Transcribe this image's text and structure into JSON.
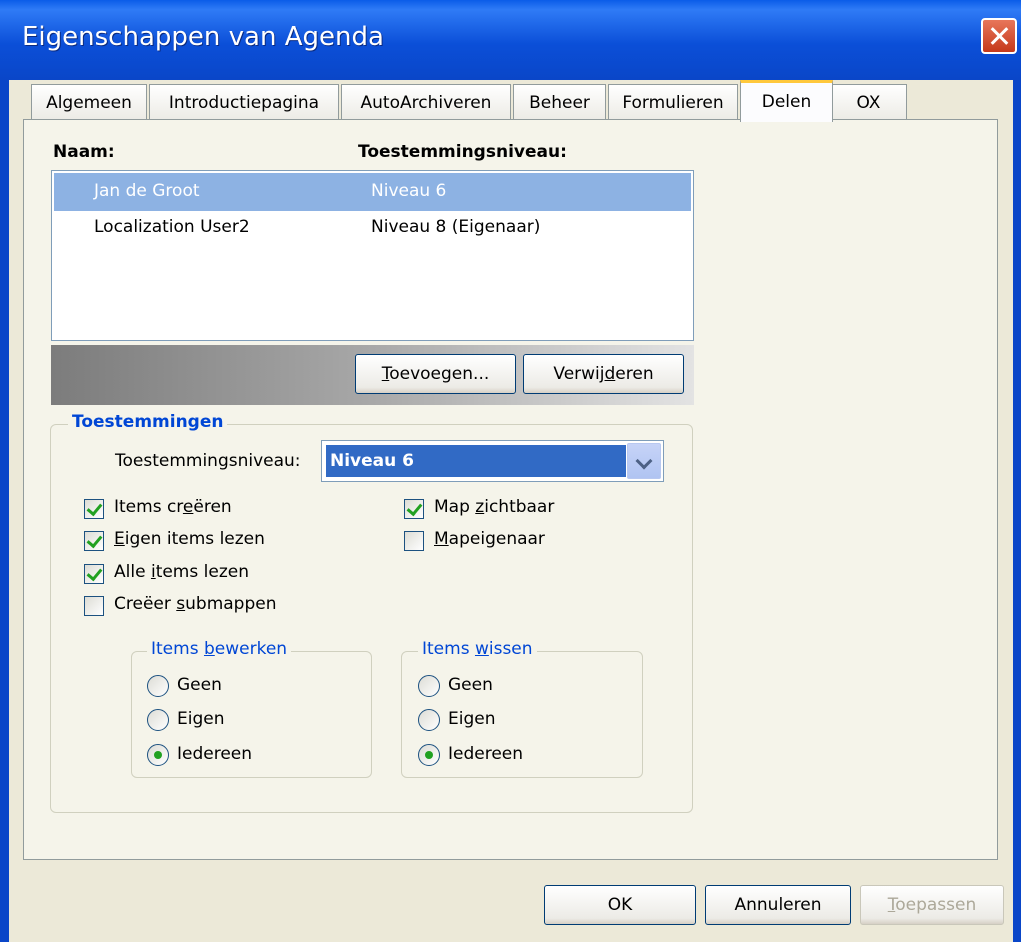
{
  "window": {
    "title": "Eigenschappen van Agenda"
  },
  "tabs": [
    "Algemeen",
    "Introductiepagina",
    "AutoArchiveren",
    "Beheer",
    "Formulieren",
    "Delen",
    "OX"
  ],
  "active_tab": "Delen",
  "list": {
    "col_name": "Naam:",
    "col_level": "Toestemmingsniveau:",
    "rows": [
      {
        "name": "Jan de Groot",
        "level": "Niveau 6",
        "selected": true
      },
      {
        "name": "Localization User2",
        "level": "Niveau 8 (Eigenaar)",
        "selected": false
      }
    ]
  },
  "buttons": {
    "add": {
      "pre": "",
      "key": "T",
      "post": "oevoegen..."
    },
    "remove": {
      "pre": "Verwij",
      "key": "d",
      "post": "eren"
    },
    "ok": "OK",
    "cancel": "Annuleren",
    "apply": {
      "pre": "",
      "key": "T",
      "post": "oepassen"
    }
  },
  "permissions": {
    "group_title": "Toestemmingen",
    "level_label": "Toestemmingsniveau:",
    "level_value": "Niveau 6",
    "checkboxes": [
      {
        "pre": "Items cr",
        "key": "e",
        "post": "ëren",
        "checked": true
      },
      {
        "pre": "",
        "key": "E",
        "post": "igen items lezen",
        "checked": true
      },
      {
        "pre": "Alle ",
        "key": "i",
        "post": "tems lezen",
        "checked": true
      },
      {
        "pre": "Creëer ",
        "key": "s",
        "post": "ubmappen",
        "checked": false
      },
      {
        "pre": "Map ",
        "key": "z",
        "post": "ichtbaar",
        "checked": true
      },
      {
        "pre": "",
        "key": "M",
        "post": "apeigenaar",
        "checked": false
      }
    ],
    "edit_group": {
      "pre": "Items ",
      "key": "b",
      "post": "ewerken",
      "options": [
        "Geen",
        "Eigen",
        "Iedereen"
      ],
      "selected": 2
    },
    "delete_group": {
      "pre": "Items ",
      "key": "w",
      "post": "issen",
      "options": [
        "Geen",
        "Eigen",
        "Iedereen"
      ],
      "selected": 2
    }
  }
}
